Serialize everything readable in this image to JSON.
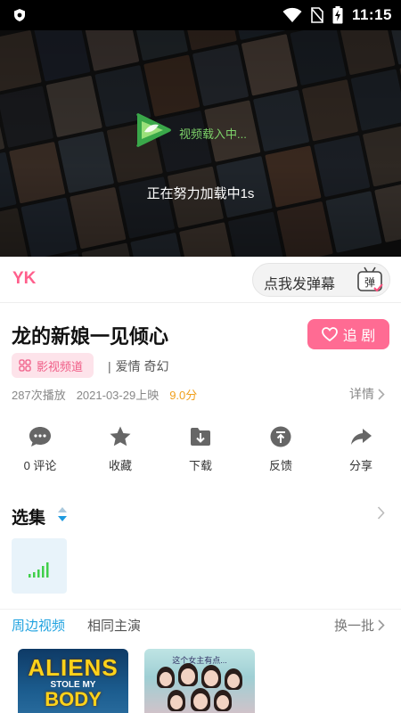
{
  "status_bar": {
    "time": "11:15"
  },
  "player": {
    "loading_label": "视频载入中...",
    "loading_status": "正在努力加载中1s"
  },
  "danmaku": {
    "logo": "YK",
    "button_text": "点我发弹幕",
    "icon_char": "弹"
  },
  "video": {
    "title": "龙的新娘一见倾心",
    "follow_label": "追 剧",
    "channel_tag": "影视频道",
    "genres": "爱情 奇幻",
    "genre_separator": "|",
    "play_count": "287次播放",
    "release": "2021-03-29上映",
    "score": "9.0分",
    "detail_label": "详情"
  },
  "actions": [
    {
      "label": "0 评论",
      "icon": "comment-icon"
    },
    {
      "label": "收藏",
      "icon": "star-icon"
    },
    {
      "label": "下载",
      "icon": "download-icon"
    },
    {
      "label": "反馈",
      "icon": "feedback-icon"
    },
    {
      "label": "分享",
      "icon": "share-icon"
    }
  ],
  "episodes": {
    "title": "选集"
  },
  "related": {
    "tabs": [
      "周边视频",
      "相同主演"
    ],
    "refresh_label": "换一批",
    "items": [
      {
        "line1": "ALIENS",
        "line2": "STOLE MY",
        "line3": "BODY"
      },
      {
        "caption": "这个女主有点..."
      }
    ]
  },
  "colors": {
    "accent_pink": "#ff6b93",
    "accent_blue": "#22a3e0",
    "score_orange": "#f0a01c",
    "signal_green": "#3fcf4a"
  }
}
